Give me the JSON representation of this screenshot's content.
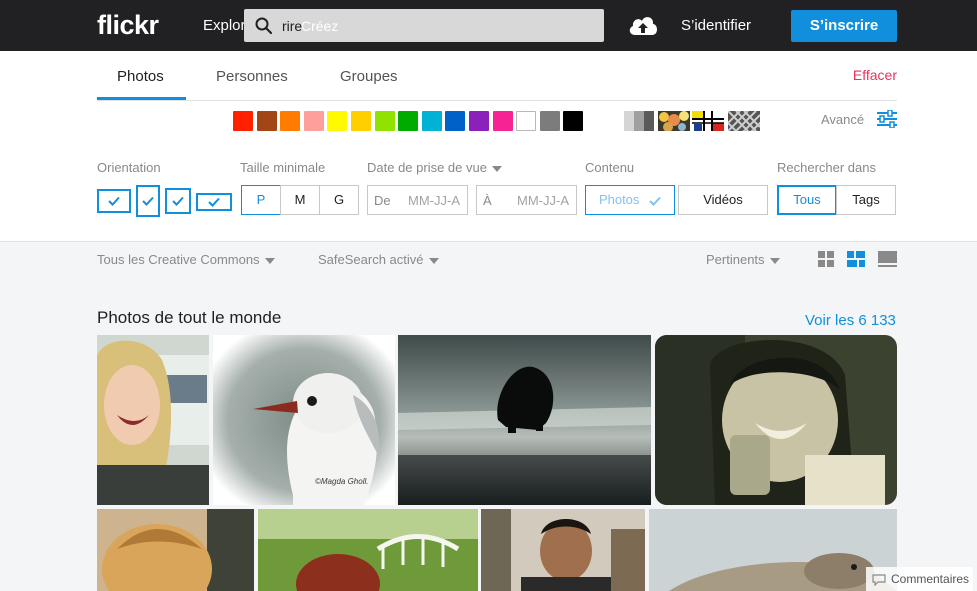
{
  "header": {
    "logo": "flickr",
    "explore_label": "Explorer",
    "explore_visible": "Explore",
    "search": {
      "value": "rire",
      "ghost_text": "Créez"
    },
    "signin_label": "S’identifier",
    "signup_label": "S’inscrire"
  },
  "tabs": [
    {
      "label": "Photos",
      "active": true
    },
    {
      "label": "Personnes",
      "active": false
    },
    {
      "label": "Groupes",
      "active": false
    }
  ],
  "clear_label": "Effacer",
  "colors": [
    "#ff2000",
    "#a24615",
    "#ff7c00",
    "#ff9f9c",
    "#fffa00",
    "#ffcf00",
    "#90e200",
    "#00ab00",
    "#00b2d4",
    "#0062c6",
    "#8c20ba",
    "#f52394",
    "#ffffff",
    "#7c7c7c",
    "#000000"
  ],
  "textures": [
    "black-and-white-icon",
    "shallow-depth-of-field-icon",
    "minimalist-icon",
    "patterns-icon"
  ],
  "advanced_label": "Avancé",
  "filters": {
    "orientation_label": "Orientation",
    "min_size_label": "Taille minimale",
    "sizes": [
      "P",
      "M",
      "G"
    ],
    "date_label": "Date de prise de vue",
    "date_from_prefix": "De",
    "date_to_prefix": "À",
    "date_placeholder": "MM-JJ-A",
    "content_label": "Contenu",
    "content_photos": "Photos",
    "content_videos": "Vidéos",
    "search_in_label": "Rechercher dans",
    "search_in_all": "Tous",
    "search_in_tags": "Tags"
  },
  "toolbar": {
    "license": "Tous les Creative Commons",
    "safesearch": "SafeSearch activé",
    "sort": "Pertinents"
  },
  "section": {
    "title": "Photos de tout le monde",
    "see_all": "Voir les 6 133"
  },
  "photo_watermark": "©Magda Gholl.",
  "comments_label": "Commentaires",
  "accent_color": "#128fdc",
  "clear_color": "#e5335d"
}
